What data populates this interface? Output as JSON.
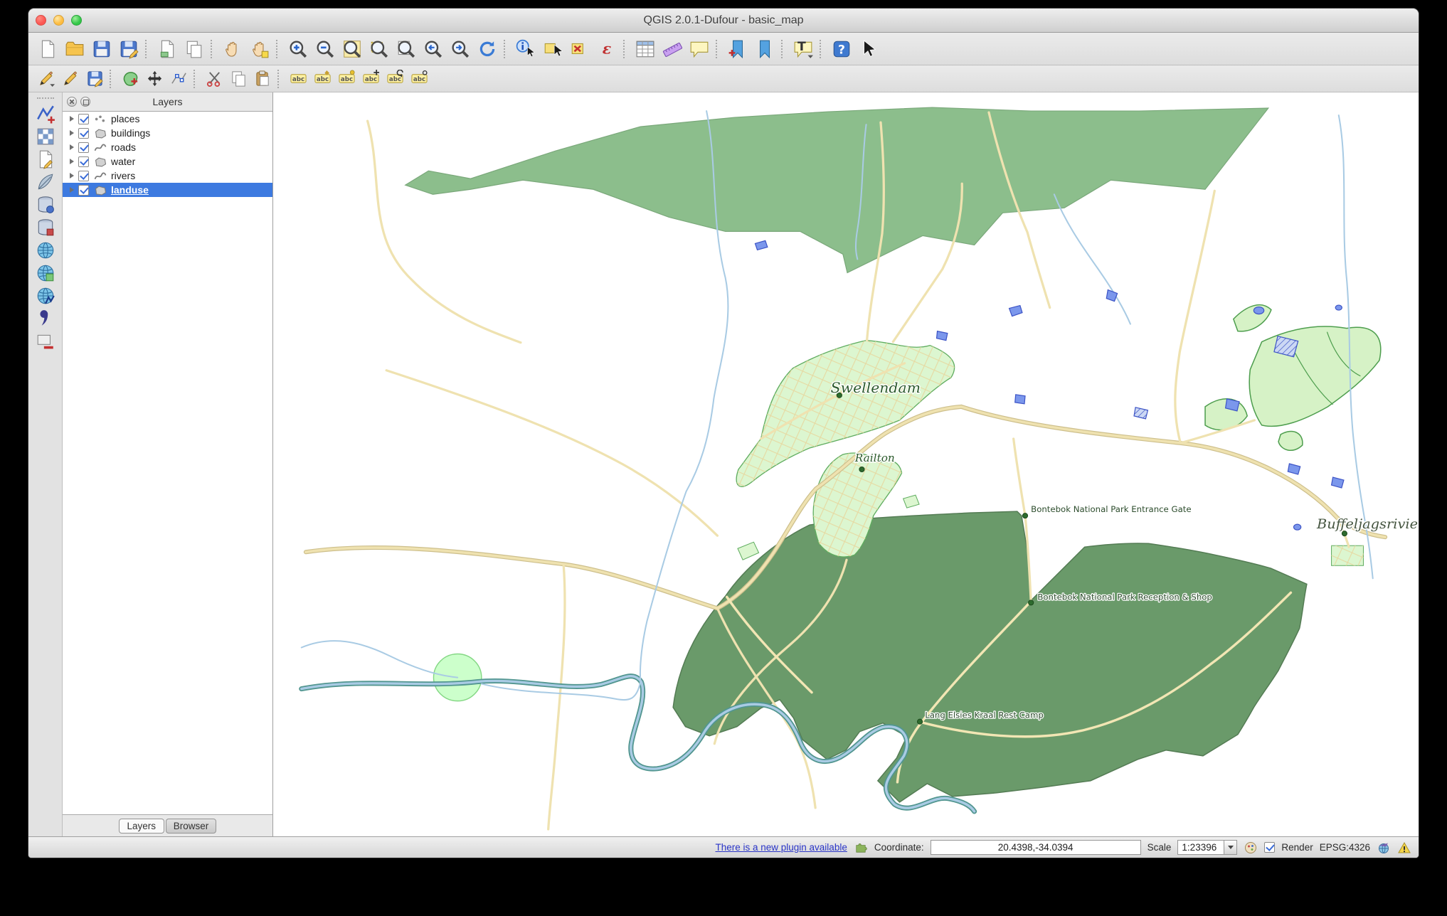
{
  "window": {
    "title": "QGIS 2.0.1-Dufour - basic_map"
  },
  "toolbars": {
    "glyphs": {
      "help": "?",
      "annotation": "T",
      "expression": "ε",
      "label": "abc"
    },
    "row1": [
      "new-project",
      "open-project",
      "save-project",
      "save-project-as",
      "new-print-composer",
      "composer-manager",
      "pan-map",
      "pan-map-to-selection",
      "zoom-in",
      "zoom-out",
      "zoom-full-extent",
      "zoom-to-selection",
      "zoom-to-layer",
      "zoom-last",
      "zoom-next",
      "refresh-map",
      "identify-features",
      "select-features",
      "deselect-features",
      "select-by-expression",
      "open-attribute-table",
      "measure-line",
      "map-tips",
      "new-bookmark",
      "show-bookmarks",
      "text-annotation",
      "help-contents",
      "whats-this"
    ],
    "row2": [
      "current-edits",
      "toggle-editing",
      "save-layer-edits",
      "add-feature",
      "move-feature",
      "node-tool",
      "cut-features",
      "copy-features",
      "paste-features",
      "labeling-options",
      "pin-unpin-labels",
      "highlight-pinned-labels",
      "move-label",
      "rotate-label",
      "change-label-properties"
    ],
    "left": [
      "add-vector-layer",
      "add-raster-layer",
      "new-shapefile-layer",
      "add-spatialite-layer",
      "add-postgis-layer",
      "add-mssql-layer",
      "add-wms-layer",
      "add-wcs-layer",
      "add-wfs-layer",
      "add-delimited-text-layer",
      "remove-layer"
    ]
  },
  "layers_panel": {
    "title": "Layers",
    "items": [
      {
        "label": "places",
        "checked": true,
        "selected": false,
        "type": "point"
      },
      {
        "label": "buildings",
        "checked": true,
        "selected": false,
        "type": "polygon"
      },
      {
        "label": "roads",
        "checked": true,
        "selected": false,
        "type": "line"
      },
      {
        "label": "water",
        "checked": true,
        "selected": false,
        "type": "polygon"
      },
      {
        "label": "rivers",
        "checked": true,
        "selected": false,
        "type": "line"
      },
      {
        "label": "landuse",
        "checked": true,
        "selected": true,
        "type": "polygon"
      }
    ],
    "tabs": {
      "layers": "Layers",
      "browser": "Browser"
    }
  },
  "map": {
    "labels": {
      "swellendam": "Swellendam",
      "railton": "Railton",
      "entrance_gate": "Bontebok National Park Entrance Gate",
      "reception": "Bontebok National Park Reception & Shop",
      "rest_camp": "Lang Elsies Kraal Rest Camp",
      "buffeljagsrivier": "Buffeljagsrivier"
    },
    "colors": {
      "forest": "#8cbe8c",
      "forest_outline": "#7aa87a",
      "park": "#6a9a6a",
      "park_outline": "#547c54",
      "urban": "#dcf6d0",
      "urban_outline": "#5fac5f",
      "roads": "#efe2b0",
      "road_casing": "#cdbf8c",
      "rivers": "#a9cbe4",
      "river_casing": "#529690",
      "water": "#7b97ec",
      "water_outline": "#3d54c6"
    }
  },
  "statusbar": {
    "plugin_link": "There is a new plugin available",
    "coordinate_label": "Coordinate:",
    "coordinate_value": "20.4398,-34.0394",
    "scale_label": "Scale",
    "scale_value": "1:23396",
    "render_label": "Render",
    "render_checked": true,
    "crs": "EPSG:4326"
  }
}
